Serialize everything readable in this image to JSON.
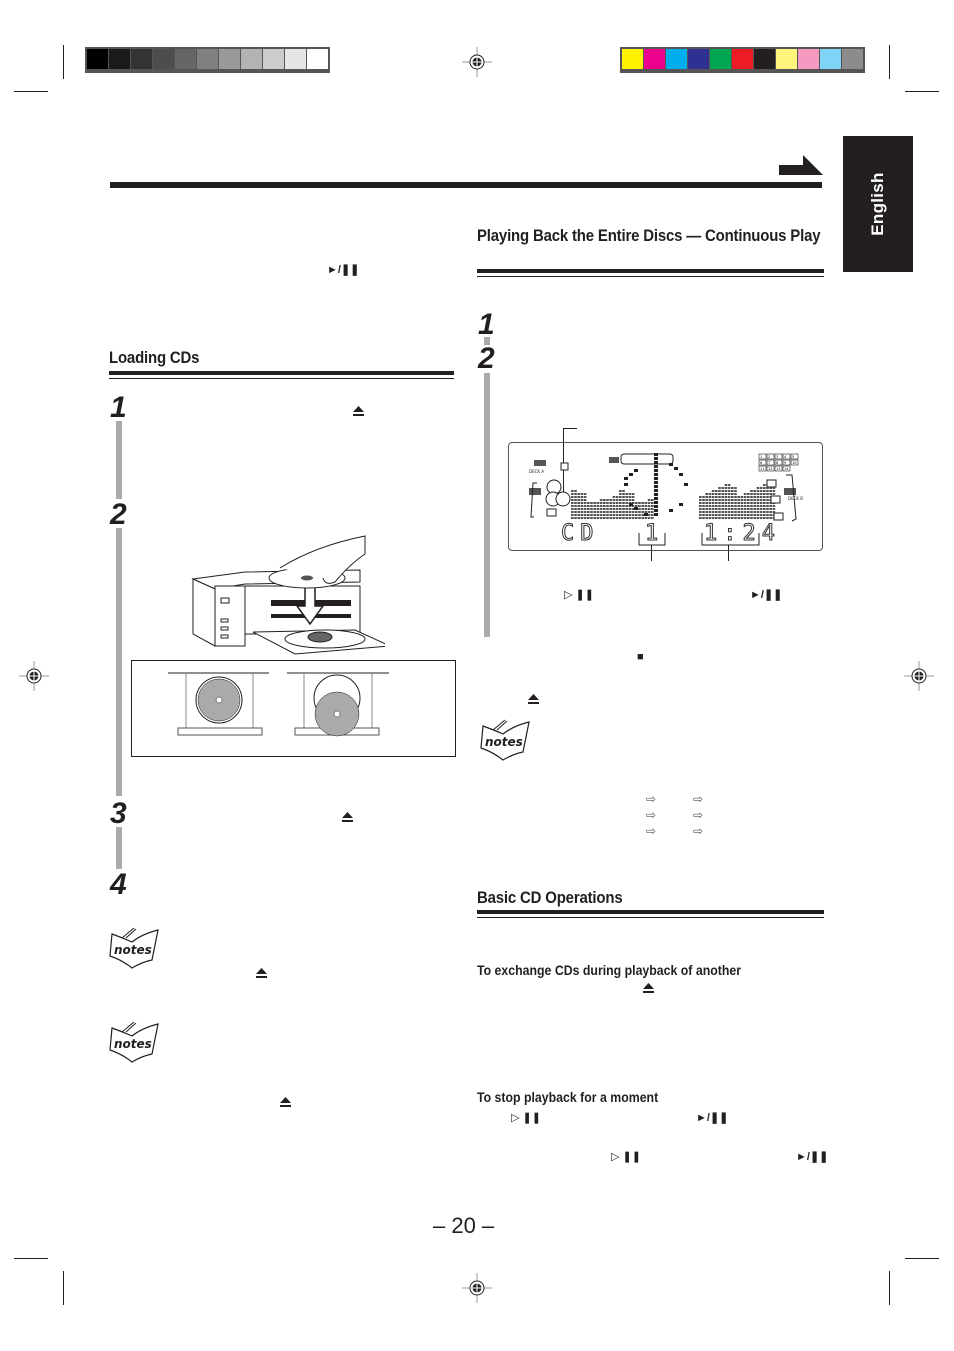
{
  "print_marks": {
    "grayscale_swatches": [
      "#000000",
      "#1a1a1a",
      "#333333",
      "#4d4d4d",
      "#666666",
      "#808080",
      "#999999",
      "#b3b3b3",
      "#cccccc",
      "#e6e6e6",
      "#ffffff"
    ],
    "color_swatches": [
      "#fff200",
      "#ec008c",
      "#00aeef",
      "#2e3192",
      "#00a651",
      "#ed1c24",
      "#231f20",
      "#fff57d",
      "#f49ac1",
      "#7fd3f6",
      "#8c8c8c"
    ]
  },
  "language_tab": "English",
  "continue_arrow": "continue-arrow-icon",
  "left_column": {
    "intro_symbol": "►/❚❚",
    "section_title": "Loading CDs",
    "steps": [
      {
        "number": "1",
        "symbols": [
          "eject-icon"
        ]
      },
      {
        "number": "2",
        "symbols": []
      },
      {
        "number": "3",
        "symbols": [
          "eject-icon"
        ]
      },
      {
        "number": "4",
        "symbols": []
      }
    ],
    "notes": [
      {
        "icon": "notes-icon",
        "label": "notes",
        "symbols": [
          "eject-icon"
        ]
      },
      {
        "icon": "notes-icon",
        "label": "notes",
        "symbols": [
          "eject-icon"
        ]
      }
    ]
  },
  "right_column": {
    "section_title": "Playing Back the Entire Discs — Continuous Play",
    "steps": [
      {
        "number": "1"
      },
      {
        "number": "2"
      }
    ],
    "display": {
      "source": "CD",
      "track_number": "1",
      "elapsed_time": "1:24",
      "labels": [
        "MD",
        "DECK A",
        "CD",
        "MD",
        "DECK B"
      ],
      "disc_numbers": [
        "1",
        "2",
        "3"
      ],
      "track_grid": [
        "1",
        "2",
        "3",
        "4",
        "5",
        "6",
        "7",
        "8",
        "9",
        "10",
        "11",
        "12",
        "13",
        "14"
      ]
    },
    "play_symbols": {
      "indicator": "▷ ❚❚",
      "button": "►/❚❚",
      "stop": "■",
      "eject": "eject-icon"
    },
    "notes_label": "notes",
    "arrow_rows": 3,
    "basic_ops": {
      "section_title": "Basic CD Operations",
      "exchange_title": "To exchange CDs during playback of another",
      "pause_title": "To stop playback for a moment",
      "indicator": "▷ ❚❚",
      "button": "►/❚❚"
    }
  },
  "page_number": "– 20 –"
}
